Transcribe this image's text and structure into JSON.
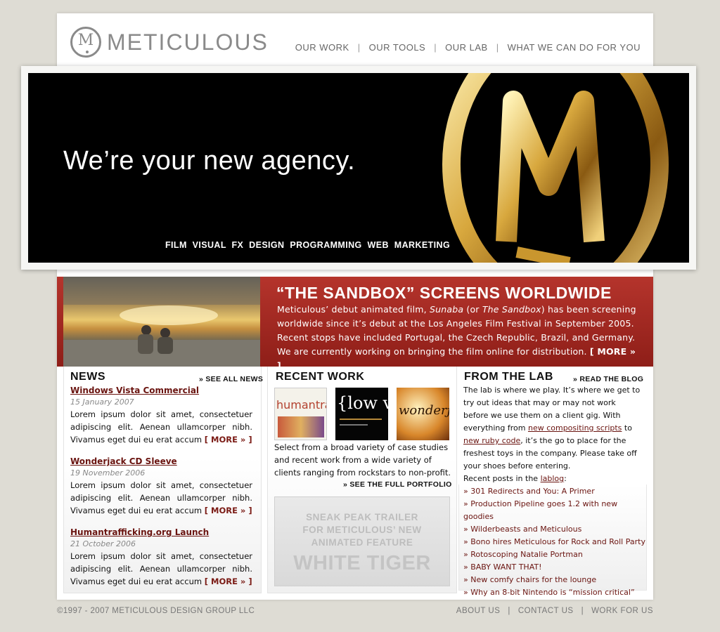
{
  "brand": {
    "name": "METICULOUS"
  },
  "nav": {
    "items": [
      "OUR WORK",
      "OUR TOOLS",
      "OUR LAB",
      "WHAT WE CAN DO FOR YOU"
    ],
    "separator": "|"
  },
  "hero": {
    "headline": "We’re your new agency.",
    "services": "FILM  VISUAL FX  DESIGN  PROGRAMMING  WEB  MARKETING"
  },
  "feature": {
    "title": "“THE SANDBOX” SCREENS WORLDWIDE",
    "body_pre": "Meticulous’ debut animated film, ",
    "body_em1": "Sunaba",
    "body_mid": " (or ",
    "body_em2": "The Sandbox",
    "body_post": ") has been screening worldwide since it’s debut at the Los Angeles Film Festival in September 2005. Recent stops have included Portugal, the Czech Republic, Brazil, and Germany. We are currently working on bringing the film online for distribution.",
    "more": "[ MORE » ]"
  },
  "news": {
    "heading": "NEWS",
    "see_all": "» SEE ALL NEWS",
    "items": [
      {
        "title": "Windows Vista Commercial",
        "date": "15 January 2007",
        "body": "Lorem ipsum dolor sit amet, consectetuer adipiscing elit. Aenean ullamcorper nibh. Vivamus eget dui eu erat accum",
        "more": "[ MORE » ]"
      },
      {
        "title": "Wonderjack CD Sleeve",
        "date": "19 November 2006",
        "body": "Lorem ipsum dolor sit amet, consectetuer adipiscing elit. Aenean ullamcorper nibh. Vivamus eget dui eu erat accum",
        "more": "[ MORE » ]"
      },
      {
        "title": "Humantrafficking.org Launch",
        "date": "21 October 2006",
        "body": "Lorem ipsum dolor sit amet, consectetuer adipiscing elit. Aenean ullamcorper nibh. Vivamus eget dui eu erat accum",
        "more": "[ MORE » ]"
      }
    ]
  },
  "work": {
    "heading": "RECENT WORK",
    "thumbs": [
      {
        "label": "humantraffi"
      },
      {
        "label": "{low v"
      },
      {
        "label": "wonderja"
      }
    ],
    "text": "Select from a broad variety of case studies and recent work from a wide variety of clients ranging from rockstars to non-profit.",
    "portfolio_link": "» SEE  THE FULL PORTFOLIO",
    "promo": {
      "line1": "SNEAK PEAK TRAILER",
      "line2": "FOR METICULOUS’ NEW",
      "line3": "ANIMATED FEATURE",
      "title": "WHITE TIGER"
    }
  },
  "lab": {
    "heading": "FROM THE LAB",
    "blog_link": "» READ THE BLOG",
    "intro_pre": "The lab is where we play. It’s where we get to try out ideas that may or may not work before we use them on a client gig.  With everything from ",
    "link1": "new compositing scripts",
    "intro_to": " to ",
    "link2": "new ruby code",
    "intro_post": ", it’s the go to place for the freshest toys in the company. Please take off your shoes before entering.",
    "recent_pre": "Recent posts in the ",
    "recent_link": "lablog",
    "recent_post": ":",
    "posts": [
      "301 Redirects and You: A Primer",
      "Production Pipeline goes 1.2 with new goodies",
      "Wilderbeasts and Meticulous",
      "Bono hires Meticulous for Rock and Roll Party",
      "Rotoscoping Natalie Portman",
      "BABY WANT THAT!",
      "New comfy chairs for the lounge",
      "Why an 8-bit Nintendo is “mission critical”"
    ]
  },
  "footer": {
    "copyright": "©1997 - 2007 METICULOUS DESIGN GROUP LLC",
    "links": [
      "ABOUT US",
      "CONTACT US",
      "WORK FOR US"
    ]
  }
}
